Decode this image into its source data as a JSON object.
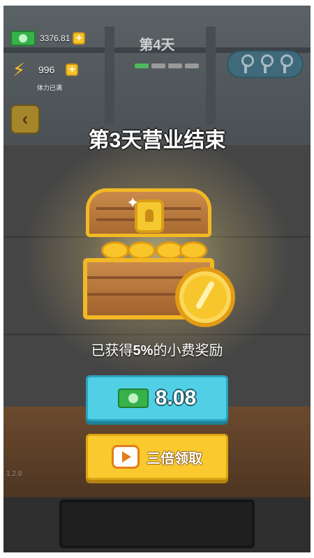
{
  "hud": {
    "cash_value": "3376.81",
    "energy_value": "996",
    "energy_status": "体力已满",
    "day_title": "第4天",
    "day_progress": [
      true,
      false,
      false,
      false
    ],
    "keys_count": 3
  },
  "overlay": {
    "headline": "第3天营业结束",
    "reward_prefix": "已获得",
    "reward_percent": "5%",
    "reward_suffix": "的小费奖励",
    "claim_value": "8.08",
    "triple_label": "三倍领取"
  },
  "footer": {
    "version": "1.2.9"
  },
  "colors": {
    "claim_button": "#50cfe5",
    "triple_button": "#f9c92d",
    "chest_gold": "#f2b825",
    "cash_green": "#37b24a"
  },
  "icons": [
    "cash-icon",
    "plus-icon",
    "lightning-icon",
    "key-icon",
    "chevron-left-icon",
    "treasure-chest-icon",
    "gold-coin-icon",
    "sparkle-icon",
    "video-icon"
  ]
}
